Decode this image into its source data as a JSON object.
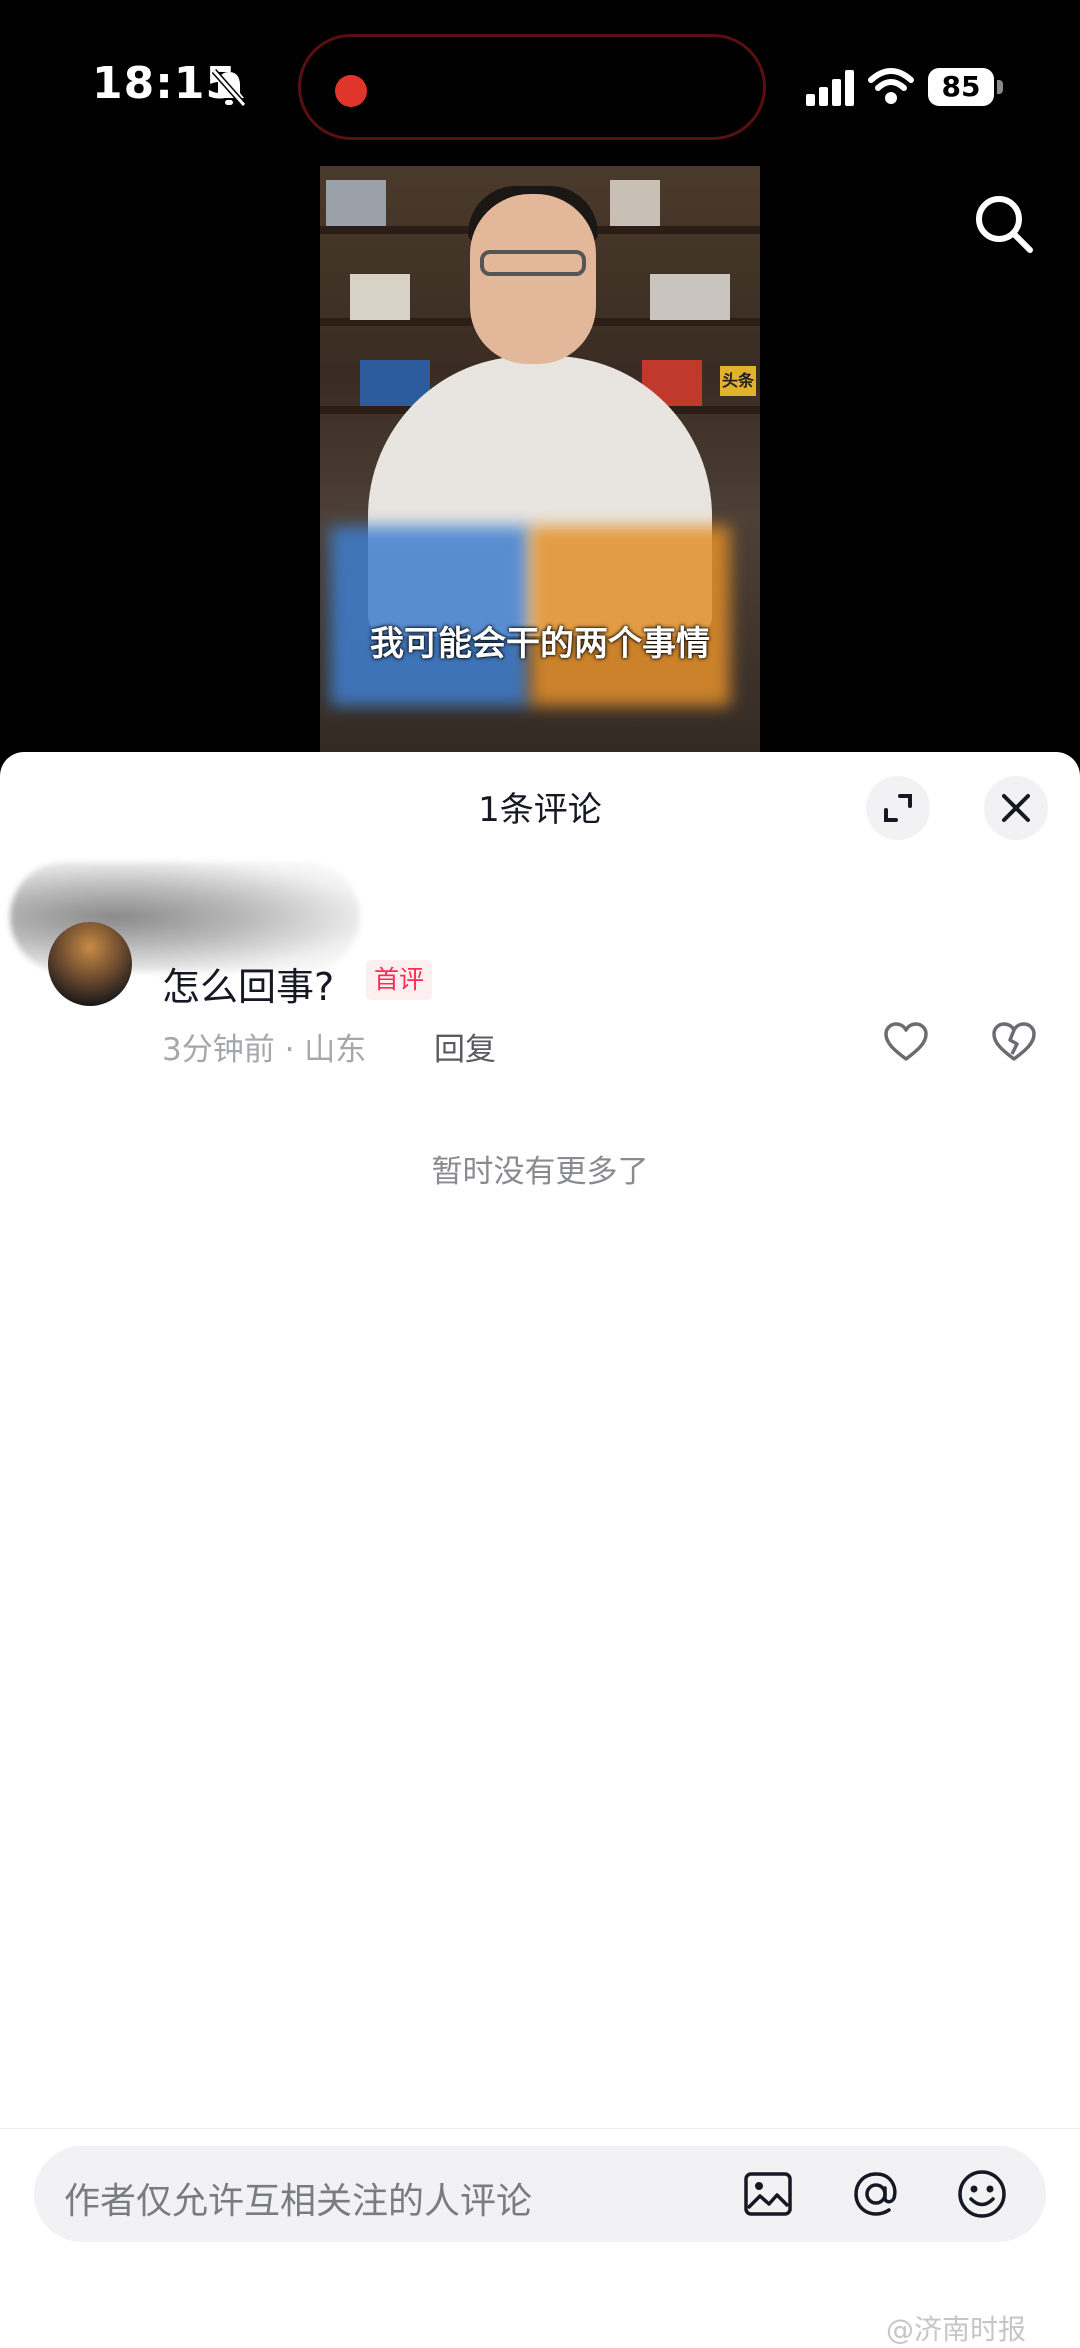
{
  "status_bar": {
    "time": "18:15",
    "battery": "85",
    "icons": [
      "bell-slash-icon",
      "recording-dot-icon",
      "signal-icon",
      "wifi-icon",
      "battery-icon"
    ]
  },
  "video": {
    "caption": "我可能会干的两个事情",
    "search_icon": "search-icon",
    "shelf_label": "头条"
  },
  "comments_sheet": {
    "title": "1条评论",
    "expand_icon": "expand-icon",
    "close_icon": "close-icon",
    "comments": [
      {
        "text": "怎么回事?",
        "badge": "首评",
        "meta": "3分钟前 · 山东",
        "reply_label": "回复",
        "like_icon": "heart-icon",
        "dislike_icon": "broken-heart-icon"
      }
    ],
    "end_text": "暂时没有更多了",
    "input": {
      "placeholder": "作者仅允许互相关注的人评论",
      "icons": [
        "image-icon",
        "at-icon",
        "emoji-icon"
      ]
    }
  },
  "watermark": "@济南时报",
  "colors": {
    "accent_badge": "#fe2c55",
    "recording": "#e0352b"
  }
}
